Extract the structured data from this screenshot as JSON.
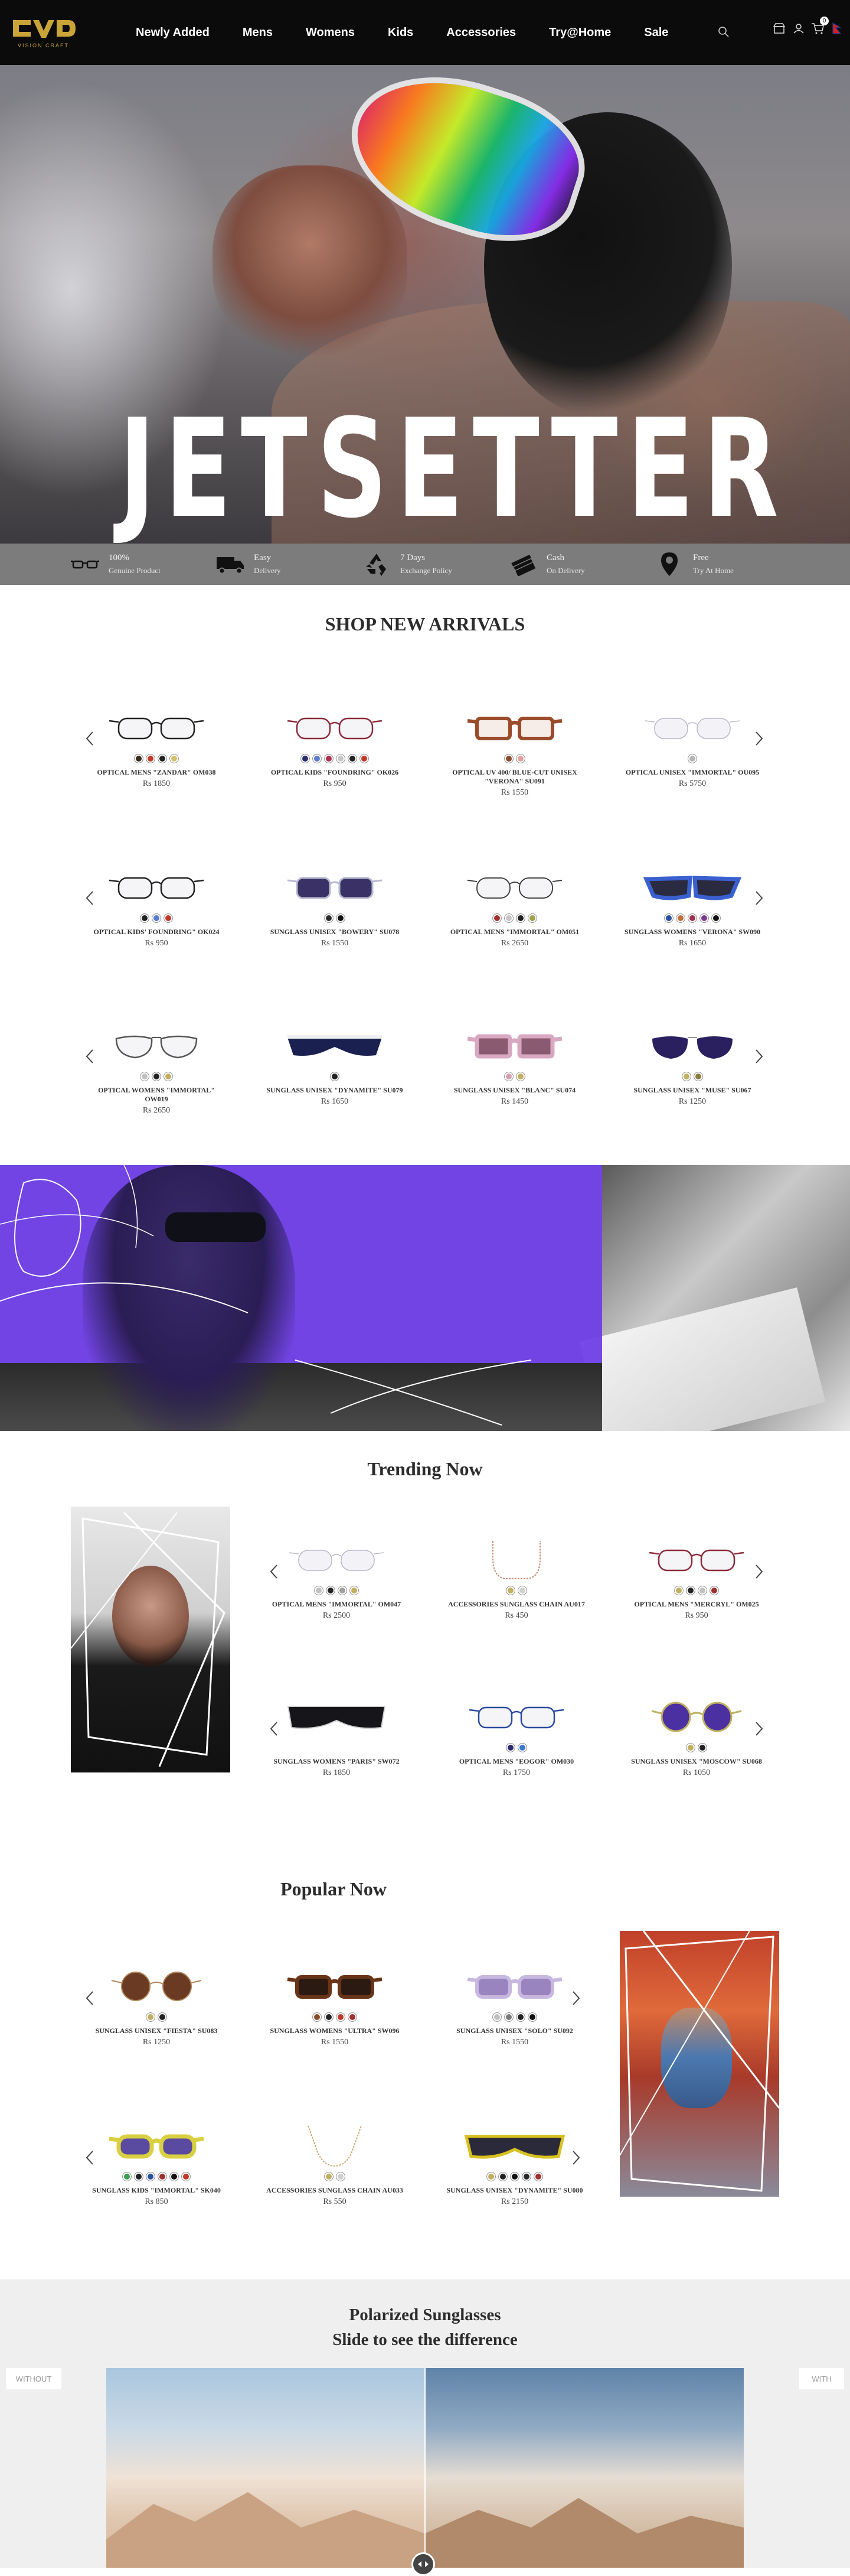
{
  "header": {
    "logo_text": "VISION CRAFT",
    "nav": [
      "Newly Added",
      "Mens",
      "Womens",
      "Kids",
      "Accessories",
      "Try@Home",
      "Sale"
    ],
    "icons": [
      "search-icon",
      "store-icon",
      "user-icon",
      "cart-icon",
      "flag-icon"
    ],
    "cart_count": "0"
  },
  "hero": {
    "title": "JETSETTER"
  },
  "features": [
    {
      "icon": "glasses-icon",
      "line1": "100%",
      "line2": "Genuine Product"
    },
    {
      "icon": "truck-icon",
      "line1": "Easy",
      "line2": "Delivery"
    },
    {
      "icon": "recycle-icon",
      "line1": "7 Days",
      "line2": "Exchange Policy"
    },
    {
      "icon": "cash-icon",
      "line1": "Cash",
      "line2": "On Delivery"
    },
    {
      "icon": "location-icon",
      "line1": "Free",
      "line2": "Try At Home"
    }
  ],
  "new_arrivals": {
    "title": "SHOP NEW ARRIVALS",
    "rows": [
      [
        {
          "name": "OPTICAL MENS \"ZANDAR\" OM038",
          "price": "Rs 1850",
          "swatches": [
            "#3a2a1a",
            "#c0392b",
            "#222222",
            "#d4c06a"
          ],
          "style": "wire-black"
        },
        {
          "name": "OPTICAL KIDS \"FOUNDRING\" OK026",
          "price": "Rs 950",
          "swatches": [
            "#2c2c6c",
            "#5a7bd0",
            "#b03050",
            "#c7c7c7",
            "#222222",
            "#c0392b"
          ],
          "style": "wire-red"
        },
        {
          "name": "OPTICAL UV 400/ BLUE-CUT UNISEX \"VERONA\" SU091",
          "price": "Rs 1550",
          "swatches": [
            "#8a4b2a",
            "#e0a0a0"
          ],
          "style": "tortoise"
        },
        {
          "name": "OPTICAL UNISEX \"IMMORTAL\" OU095",
          "price": "Rs 5750",
          "swatches": [
            "#b5b5b5"
          ],
          "style": "rimless"
        }
      ],
      [
        {
          "name": "OPTICAL KIDS' FOUNDRING\" OK024",
          "price": "Rs 950",
          "swatches": [
            "#222222",
            "#5a7bd0",
            "#c0392b"
          ],
          "style": "wire-black"
        },
        {
          "name": "SUNGLASS UNISEX \"BOWERY\" SU078",
          "price": "Rs 1550",
          "swatches": [
            "#2c2c2c",
            "#111111"
          ],
          "style": "dark-purple"
        },
        {
          "name": "OPTICAL MENS \"IMMORTAL\" OM051",
          "price": "Rs 2650",
          "swatches": [
            "#a03030",
            "#c7c7c7",
            "#222222",
            "#a0a050"
          ],
          "style": "rimless-black"
        },
        {
          "name": "SUNGLASS WOMENS \"VERONA\" SW090",
          "price": "Rs 1650",
          "swatches": [
            "#2a50a0",
            "#c07040",
            "#a03050",
            "#7a3a90",
            "#111111"
          ],
          "style": "blue-cat"
        }
      ],
      [
        {
          "name": "OPTICAL WOMENS \"IMMORTAL\" OW019",
          "price": "Rs 2650",
          "swatches": [
            "#c0c0c0",
            "#222222",
            "#c0b060"
          ],
          "style": "aviator"
        },
        {
          "name": "SUNGLASS UNISEX \"DYNAMITE\" SU079",
          "price": "Rs 1650",
          "swatches": [
            "#222222"
          ],
          "style": "navy-shield"
        },
        {
          "name": "SUNGLASS UNISEX \"BLANC\" SU074",
          "price": "Rs 1450",
          "swatches": [
            "#d4a0b0",
            "#c0b060"
          ],
          "style": "pink-rect"
        },
        {
          "name": "SUNGLASS UNISEX \"MUSE\" SU067",
          "price": "Rs 1250",
          "swatches": [
            "#c0b060",
            "#8a7a40"
          ],
          "style": "purple-aviator"
        }
      ]
    ]
  },
  "trending": {
    "title": "Trending Now",
    "rows": [
      [
        {
          "name": "OPTICAL MENS \"IMMORTAL\" OM047",
          "price": "Rs 2500",
          "swatches": [
            "#c0c0c0",
            "#222222",
            "#a0a0a0",
            "#c0b060"
          ],
          "style": "rimless"
        },
        {
          "name": "ACCESSORIES SUNGLASS CHAIN AU017",
          "price": "Rs 450",
          "swatches": [
            "#c0b060",
            "#d0d0d0"
          ],
          "style": "chain"
        },
        {
          "name": "OPTICAL MENS \"MERCRYL\" OM025",
          "price": "Rs 950",
          "swatches": [
            "#c0b060",
            "#222222",
            "#c0c0c0",
            "#a03030"
          ],
          "style": "wire-red"
        }
      ],
      [
        {
          "name": "SUNGLASS WOMENS \"PARIS\" SW072",
          "price": "Rs 1850",
          "swatches": [],
          "style": "black-shield"
        },
        {
          "name": "OPTICAL MENS \"EOGOR\" OM030",
          "price": "Rs 1750",
          "swatches": [
            "#2c2c6c",
            "#3a7ad0"
          ],
          "style": "wire-blue"
        },
        {
          "name": "SUNGLASS UNISEX \"MOSCOW\" SU068",
          "price": "Rs 1050",
          "swatches": [
            "#c0b060",
            "#222222"
          ],
          "style": "purple-round"
        }
      ]
    ]
  },
  "popular": {
    "title": "Popular Now",
    "rows": [
      [
        {
          "name": "SUNGLASS UNISEX \"FIESTA\" SU083",
          "price": "Rs 1250",
          "swatches": [
            "#c0b060",
            "#222222"
          ],
          "style": "brown-round"
        },
        {
          "name": "SUNGLASS WOMENS \"ULTRA\" SW096",
          "price": "Rs 1550",
          "swatches": [
            "#8a4b2a",
            "#222222",
            "#c0392b",
            "#a03030"
          ],
          "style": "tortoise-dark"
        },
        {
          "name": "SUNGLASS UNISEX \"SOLO\" SU092",
          "price": "Rs 1550",
          "swatches": [
            "#c0c0c0",
            "#7a7a7a",
            "#222222",
            "#111111"
          ],
          "style": "lilac"
        }
      ],
      [
        {
          "name": "SUNGLASS KIDS \"IMMORTAL\" SK040",
          "price": "Rs 850",
          "swatches": [
            "#3aa050",
            "#222222",
            "#2a50a0",
            "#a03030",
            "#111111",
            "#c0392b"
          ],
          "style": "yellow-kids"
        },
        {
          "name": "ACCESSORIES SUNGLASS CHAIN AU033",
          "price": "Rs 550",
          "swatches": [
            "#c0b060",
            "#d0d0d0"
          ],
          "style": "chain-gold"
        },
        {
          "name": "SUNGLASS UNISEX \"DYNAMITE\" SU080",
          "price": "Rs 2150",
          "swatches": [
            "#c0b060",
            "#222222",
            "#111111",
            "#2a2a2a",
            "#a03030"
          ],
          "style": "yellow-shield"
        }
      ]
    ]
  },
  "polarized": {
    "title_line1": "Polarized Sunglasses",
    "title_line2": "Slide to see the difference",
    "without_label": "WITHOUT",
    "with_label": "WITH"
  }
}
